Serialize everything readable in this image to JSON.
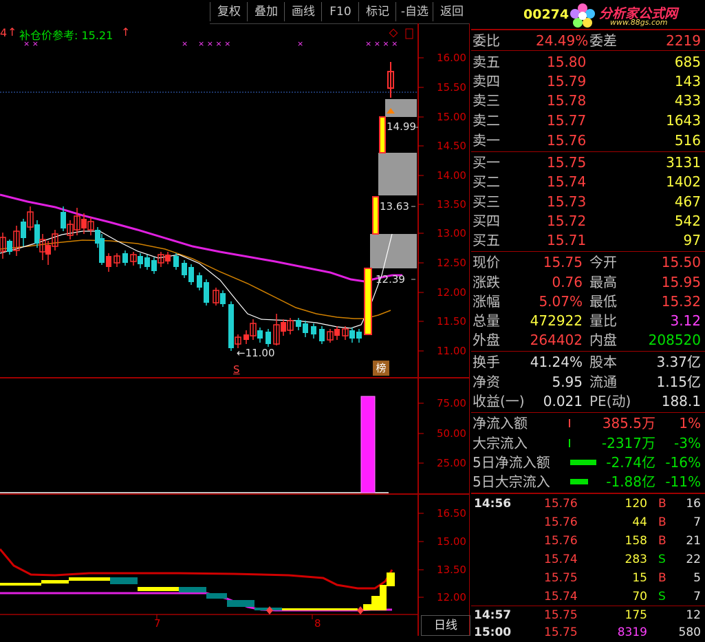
{
  "toolbar": {
    "buttons": [
      "复权",
      "叠加",
      "画线",
      "F10",
      "标记",
      "-自选",
      "返回"
    ]
  },
  "header": {
    "stock_code": "00274",
    "logo_text": "分析家公式网",
    "logo_url": "www.88gs.com"
  },
  "indicator": {
    "prefix": "4",
    "label": "补仓价参考: 15.21",
    "arrow": "↑"
  },
  "price_axis": [
    "16.00",
    "15.50",
    "15.00",
    "14.50",
    "14.00",
    "13.50",
    "13.00",
    "12.50",
    "12.00",
    "11.50",
    "11.00"
  ],
  "price_annotations": {
    "a1": "14.99",
    "a2": "13.63",
    "a3": "12.39",
    "low": "←11.00",
    "s_mark": "S",
    "bang": "榜"
  },
  "volume_axis": [
    "75.00",
    "50.00",
    "25.00"
  ],
  "lower_axis": [
    "16.50",
    "15.00",
    "13.50",
    "12.00"
  ],
  "date_labels": [
    "7",
    "8"
  ],
  "period_label": "日线",
  "order_book": {
    "weibi_label": "委比",
    "weibi_value": "24.49%",
    "weicha_label": "委差",
    "weicha_value": "2219",
    "sells": [
      {
        "label": "卖五",
        "price": "15.80",
        "vol": "685"
      },
      {
        "label": "卖四",
        "price": "15.79",
        "vol": "143"
      },
      {
        "label": "卖三",
        "price": "15.78",
        "vol": "433"
      },
      {
        "label": "卖二",
        "price": "15.77",
        "vol": "1643"
      },
      {
        "label": "卖一",
        "price": "15.76",
        "vol": "516"
      }
    ],
    "buys": [
      {
        "label": "买一",
        "price": "15.75",
        "vol": "3131"
      },
      {
        "label": "买二",
        "price": "15.74",
        "vol": "1402"
      },
      {
        "label": "买三",
        "price": "15.73",
        "vol": "467"
      },
      {
        "label": "买四",
        "price": "15.72",
        "vol": "542"
      },
      {
        "label": "买五",
        "price": "15.71",
        "vol": "97"
      }
    ]
  },
  "quote": {
    "rows": [
      {
        "l1": "现价",
        "v1": "15.75",
        "l2": "今开",
        "v2": "15.50"
      },
      {
        "l1": "涨跌",
        "v1": "0.76",
        "l2": "最高",
        "v2": "15.95"
      },
      {
        "l1": "涨幅",
        "v1": "5.07%",
        "l2": "最低",
        "v2": "15.32"
      },
      {
        "l1": "总量",
        "v1": "472922",
        "l2": "量比",
        "v2": "3.12"
      },
      {
        "l1": "外盘",
        "v1": "264402",
        "l2": "内盘",
        "v2": "208520"
      }
    ]
  },
  "fundamentals": {
    "rows": [
      {
        "l1": "换手",
        "v1": "41.24%",
        "l2": "股本",
        "v2": "3.37亿"
      },
      {
        "l1": "净资",
        "v1": "5.95",
        "l2": "流通",
        "v2": "1.15亿"
      },
      {
        "l1": "收益(一)",
        "v1": "0.021",
        "l2": "PE(动)",
        "v2": "188.1"
      }
    ]
  },
  "flows": [
    {
      "label": "净流入额",
      "value": "385.5万",
      "pct": "1%"
    },
    {
      "label": "大宗流入",
      "value": "-2317万",
      "pct": "-3%"
    },
    {
      "label": "5日净流入额",
      "value": "-2.74亿",
      "pct": "-16%"
    },
    {
      "label": "5日大宗流入",
      "value": "-1.88亿",
      "pct": "-11%"
    }
  ],
  "ticks": [
    {
      "time": "14:56",
      "price": "15.76",
      "vol": "120",
      "side": "B",
      "n": "16"
    },
    {
      "time": "",
      "price": "15.76",
      "vol": "44",
      "side": "B",
      "n": "7"
    },
    {
      "time": "",
      "price": "15.76",
      "vol": "158",
      "side": "B",
      "n": "21"
    },
    {
      "time": "",
      "price": "15.74",
      "vol": "283",
      "side": "S",
      "n": "22"
    },
    {
      "time": "",
      "price": "15.75",
      "vol": "15",
      "side": "B",
      "n": "5"
    },
    {
      "time": "",
      "price": "15.74",
      "vol": "70",
      "side": "S",
      "n": "7"
    },
    {
      "time": "14:57",
      "price": "15.75",
      "vol": "175",
      "side": "",
      "n": "12"
    },
    {
      "time": "15:00",
      "price": "15.75",
      "vol": "8319",
      "side": "",
      "n": "580"
    }
  ]
}
